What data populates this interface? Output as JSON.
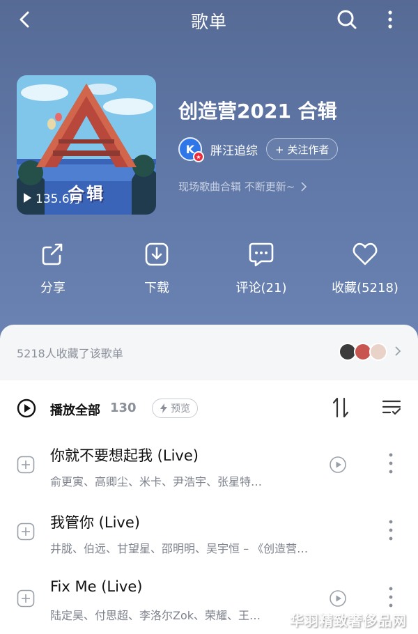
{
  "header": {
    "title": "歌单"
  },
  "playlist": {
    "cover_title": "合辑",
    "play_count": "135.6万",
    "title": "创造营2021 合辑",
    "author": "胖汪追综",
    "avatar_letter": "K",
    "follow_label": "+ 关注作者",
    "description": "现场歌曲合辑 不断更新~"
  },
  "actions": [
    {
      "label": "分享",
      "icon": "share-icon"
    },
    {
      "label": "下载",
      "icon": "download-icon"
    },
    {
      "label": "评论(21)",
      "icon": "comment-icon"
    },
    {
      "label": "收藏(5218)",
      "icon": "heart-icon"
    }
  ],
  "collect": {
    "text": "5218人收藏了该歌单"
  },
  "list": {
    "play_all_label": "播放全部",
    "count": "130",
    "preview_label": "预览"
  },
  "songs": [
    {
      "title": "你就不要想起我 (Live)",
      "artists": "俞更寅、高卿尘、米卡、尹浩宇、张星特…"
    },
    {
      "title": "我管你 (Live)",
      "artists": "井胧、伯远、甘望星、邵明明、吴宇恒 – 《创造营…"
    },
    {
      "title": "Fix Me (Live)",
      "artists": "陆定昊、付思超、李洛尔Zok、荣耀、王…"
    }
  ],
  "watermark": "华羽精致奢侈品网",
  "colors": {
    "accent": "#2f76e8",
    "hero_bg": "#5f77a6"
  }
}
